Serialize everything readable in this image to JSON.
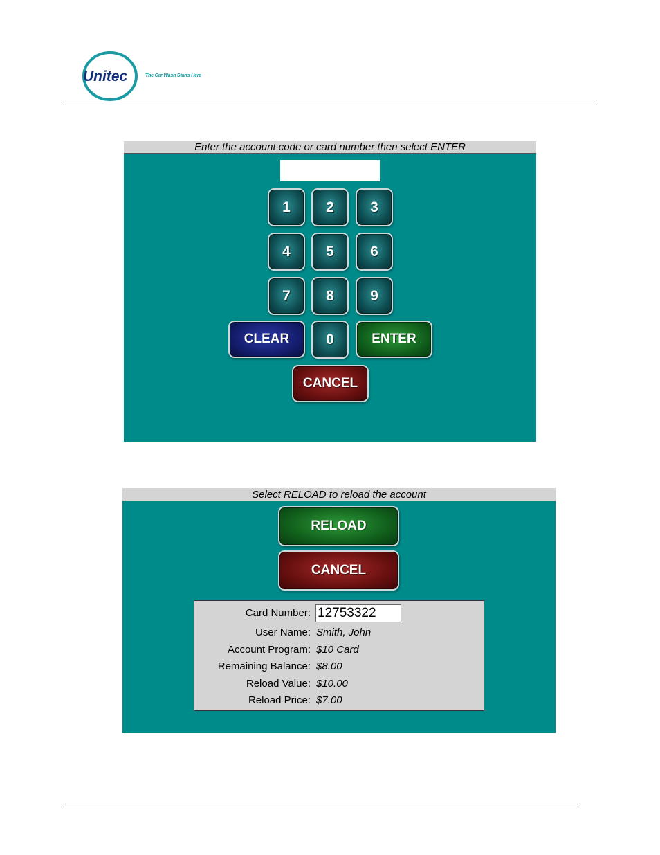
{
  "header": {
    "brand_name": "Unitec",
    "tagline": "The Car Wash Starts Here"
  },
  "screen1": {
    "prompt": "Enter the account code or card number then select ENTER",
    "code_input_value": "",
    "keys": {
      "k1": "1",
      "k2": "2",
      "k3": "3",
      "k4": "4",
      "k5": "5",
      "k6": "6",
      "k7": "7",
      "k8": "8",
      "k9": "9",
      "k0": "0"
    },
    "clear_label": "CLEAR",
    "enter_label": "ENTER",
    "cancel_label": "CANCEL"
  },
  "screen2": {
    "prompt": "Select RELOAD to reload the account",
    "reload_label": "RELOAD",
    "cancel_label": "CANCEL",
    "info": {
      "card_number_label": "Card Number:",
      "card_number_value": "12753322",
      "user_name_label": "User Name:",
      "user_name_value": "Smith, John",
      "account_program_label": "Account Program:",
      "account_program_value": "$10 Card",
      "remaining_balance_label": "Remaining Balance:",
      "remaining_balance_value": "$8.00",
      "reload_value_label": "Reload Value:",
      "reload_value_value": "$10.00",
      "reload_price_label": "Reload Price:",
      "reload_price_value": "$7.00"
    }
  },
  "colors": {
    "screen_background": "#008b8b",
    "title_bar": "#d4d4d4",
    "logo_teal": "#1a9aa3",
    "logo_navy": "#12307a"
  }
}
